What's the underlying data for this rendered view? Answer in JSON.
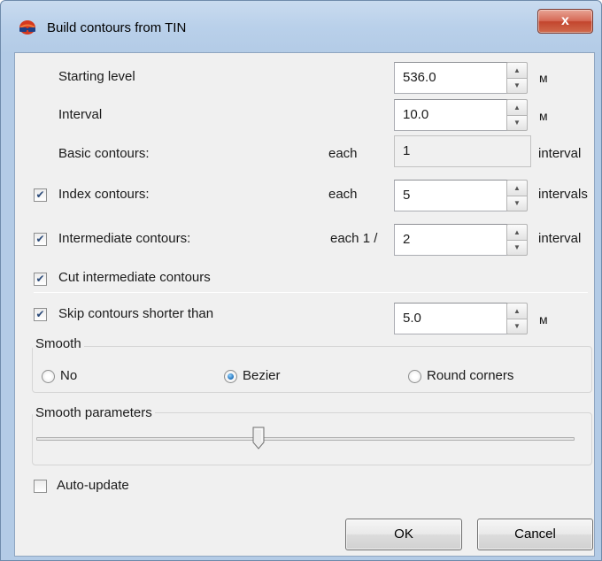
{
  "window": {
    "title": "Build contours from TIN",
    "close_label": "x"
  },
  "rows": {
    "starting_level": {
      "label": "Starting level",
      "value": "536.0",
      "unit": "м"
    },
    "interval": {
      "label": "Interval",
      "value": "10.0",
      "unit": "м"
    },
    "basic_contours": {
      "label": "Basic contours:",
      "prefix": "each",
      "value": "1",
      "suffix": "interval"
    },
    "index_contours": {
      "label": "Index contours:",
      "checked": true,
      "prefix": "each",
      "value": "5",
      "suffix": "intervals"
    },
    "intermediate_contours": {
      "label": "Intermediate contours:",
      "checked": true,
      "prefix": "each 1 /",
      "value": "2",
      "suffix": "interval"
    },
    "cut_intermediate": {
      "label": "Cut intermediate contours",
      "checked": true
    },
    "skip_shorter": {
      "label": "Skip contours shorter than",
      "checked": true,
      "value": "5.0",
      "unit": "м"
    }
  },
  "smooth": {
    "title": "Smooth",
    "options": [
      {
        "label": "No",
        "selected": false
      },
      {
        "label": "Bezier",
        "selected": true
      },
      {
        "label": "Round corners",
        "selected": false
      }
    ]
  },
  "smooth_parameters": {
    "title": "Smooth parameters",
    "slider_fraction": 0.42
  },
  "auto_update": {
    "label": "Auto-update",
    "checked": false
  },
  "buttons": {
    "ok": "OK",
    "cancel": "Cancel"
  },
  "colors": {
    "title_bar": "#b9d0ea",
    "close_button": "#c3452e",
    "dialog_bg": "#f0f0f0"
  }
}
